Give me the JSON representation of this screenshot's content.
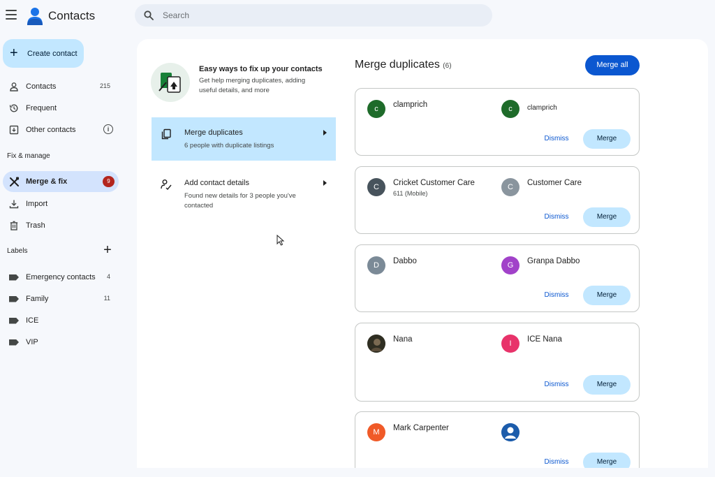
{
  "app": {
    "title": "Contacts"
  },
  "search": {
    "placeholder": "Search"
  },
  "sidebar": {
    "create_label": "Create contact",
    "items": [
      {
        "label": "Contacts",
        "count": "215"
      },
      {
        "label": "Frequent"
      },
      {
        "label": "Other contacts",
        "info": "i"
      }
    ],
    "fix_heading": "Fix & manage",
    "fix_items": [
      {
        "label": "Merge & fix",
        "badge": "9"
      },
      {
        "label": "Import"
      },
      {
        "label": "Trash"
      }
    ],
    "labels_heading": "Labels",
    "labels_add": "+",
    "labels": [
      {
        "label": "Emergency contacts",
        "count": "4"
      },
      {
        "label": "Family",
        "count": "11"
      },
      {
        "label": "ICE"
      },
      {
        "label": "VIP"
      }
    ]
  },
  "intro": {
    "title": "Easy ways to fix up your contacts",
    "subtitle": "Get help merging duplicates, adding useful details, and more"
  },
  "fix_options": [
    {
      "title": "Merge duplicates",
      "subtitle": "6 people with duplicate listings"
    },
    {
      "title": "Add contact details",
      "subtitle": "Found new details for 3 people you've contacted"
    }
  ],
  "merge": {
    "heading": "Merge duplicates",
    "count": "(6)",
    "merge_all_label": "Merge all",
    "dismiss_label": "Dismiss",
    "merge_label": "Merge",
    "cards": [
      {
        "left": {
          "name": "clamprich",
          "initial": "c",
          "color": "#1e6b2a"
        },
        "right": {
          "name": "clamprich",
          "initial": "c",
          "color": "#1e6b2a"
        }
      },
      {
        "left": {
          "name": "Cricket Customer Care",
          "sub": "611 (Mobile)",
          "initial": "C",
          "color": "#47535c"
        },
        "right": {
          "name": "Customer Care",
          "initial": "C",
          "color": "#8a959e"
        }
      },
      {
        "left": {
          "name": "Dabbo",
          "initial": "D",
          "color": "#7b8a97"
        },
        "right": {
          "name": "Granpa Dabbo",
          "initial": "G",
          "color": "#a142c9"
        }
      },
      {
        "left": {
          "name": "Nana",
          "initial": "",
          "color": "#3b3a2a"
        },
        "right": {
          "name": "ICE Nana",
          "initial": "I",
          "color": "#e8336a"
        }
      },
      {
        "left": {
          "name": "Mark Carpenter",
          "initial": "M",
          "color": "#f05a28"
        },
        "right": {
          "name": "",
          "initial": "",
          "color": "#1c5cab"
        }
      }
    ]
  }
}
